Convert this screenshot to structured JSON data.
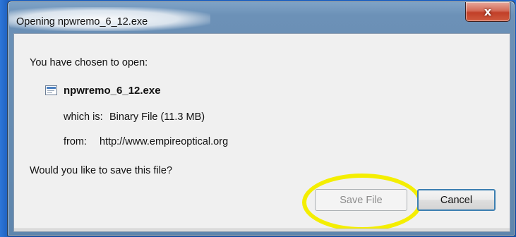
{
  "window": {
    "title": "Opening npwremo_6_12.exe",
    "close_label": "x"
  },
  "dialog": {
    "intro": "You have chosen to open:",
    "file_name": "npwremo_6_12.exe",
    "which_is_label": "which is:",
    "which_is_value": "Binary File (11.3 MB)",
    "from_label": "from:",
    "from_value": "http://www.empireoptical.org",
    "question": "Would you like to save this file?"
  },
  "buttons": {
    "save_label": "Save File",
    "cancel_label": "Cancel"
  },
  "icons": {
    "file": "executable-file-icon",
    "close": "close-icon"
  },
  "colors": {
    "highlight_ring": "#f4ee00",
    "desktop": "#1b5fc6"
  }
}
